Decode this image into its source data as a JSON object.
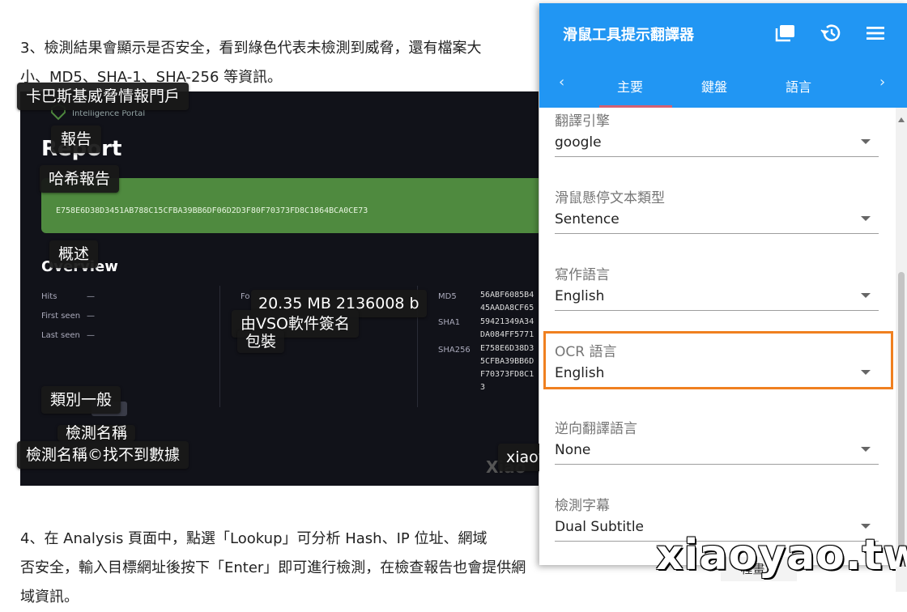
{
  "article": {
    "para1_line1": "3、檢測結果會顯示是否安全，看到綠色代表未檢測到威脅，還有檔案大",
    "para1_line2": "小、MD5、SHA-1、SHA-256 等資訊。",
    "para2_line1": "4、在 Analysis 頁面中，點選「Lookup」可分析 Hash、IP 位址、網域",
    "para2_line2": "否安全，輸入目標網址後按下「Enter」即可進行檢測，在檢查報告也會提供網",
    "para2_line3": "域資訊。"
  },
  "screenshot": {
    "portal_text": "Intelligence Portal",
    "report_heading": "Report",
    "hash": "E758E6D38D3451AB788C15CFBA39BB6DF06D2D3F80F70373FD8C1864BCA0CE73",
    "overview_heading": "Overview",
    "hits_label": "Hits",
    "hits_value": "—",
    "first_seen_label": "First seen",
    "first_seen_value": "—",
    "last_seen_label": "Last seen",
    "last_seen_value": "—",
    "fo_label": "Fo",
    "md5_label": "MD5",
    "md5_value_1": "56ABF6085B4",
    "md5_value_2": "45AADA8CF65",
    "sha1_label": "SHA1",
    "sha1_value_1": "59421349A34",
    "sha1_value_2": "DA084FF5771",
    "sha256_label": "SHA256",
    "sha256_value_1": "E758E6D38D3",
    "sha256_value_2": "5CFBA39BB6D",
    "sha256_value_3": "F70373FD8C1",
    "sha256_value_4": "3",
    "watermark_partial": "Xiao"
  },
  "tooltips": {
    "t1": "卡巴斯基威脅情報門戶",
    "t2": "報告",
    "t3": "哈希報告",
    "t4": "概述",
    "t5": "20.35 MB 2136008 b",
    "t6": "由VSO軟件簽名",
    "t7": "包裝",
    "t8": "類別一般",
    "t9": "檢測名稱",
    "t10": "檢測名稱©找不到數據",
    "t11": "xiaoy"
  },
  "panel": {
    "title": "滑鼠工具提示翻譯器",
    "icons": [
      "window-icon",
      "history-icon",
      "menu-icon"
    ],
    "tabs": {
      "prev": "‹",
      "main": "主要",
      "keyboard": "鍵盤",
      "language": "語言",
      "next": "›"
    },
    "fields": [
      {
        "label": "翻譯引擎",
        "value": "google"
      },
      {
        "label": "滑鼠懸停文本類型",
        "value": "Sentence"
      },
      {
        "label": "寫作語言",
        "value": "English"
      },
      {
        "label": "OCR 語言",
        "value": "English"
      },
      {
        "label": "逆向翻譯語言",
        "value": "None"
      },
      {
        "label": "檢測字幕",
        "value": "Dual Subtitle"
      }
    ],
    "accent_color": "#2196f3",
    "highlight_color": "#f08020"
  },
  "bottom_button": "程畫賞",
  "watermark": "xiaoyao.tw"
}
